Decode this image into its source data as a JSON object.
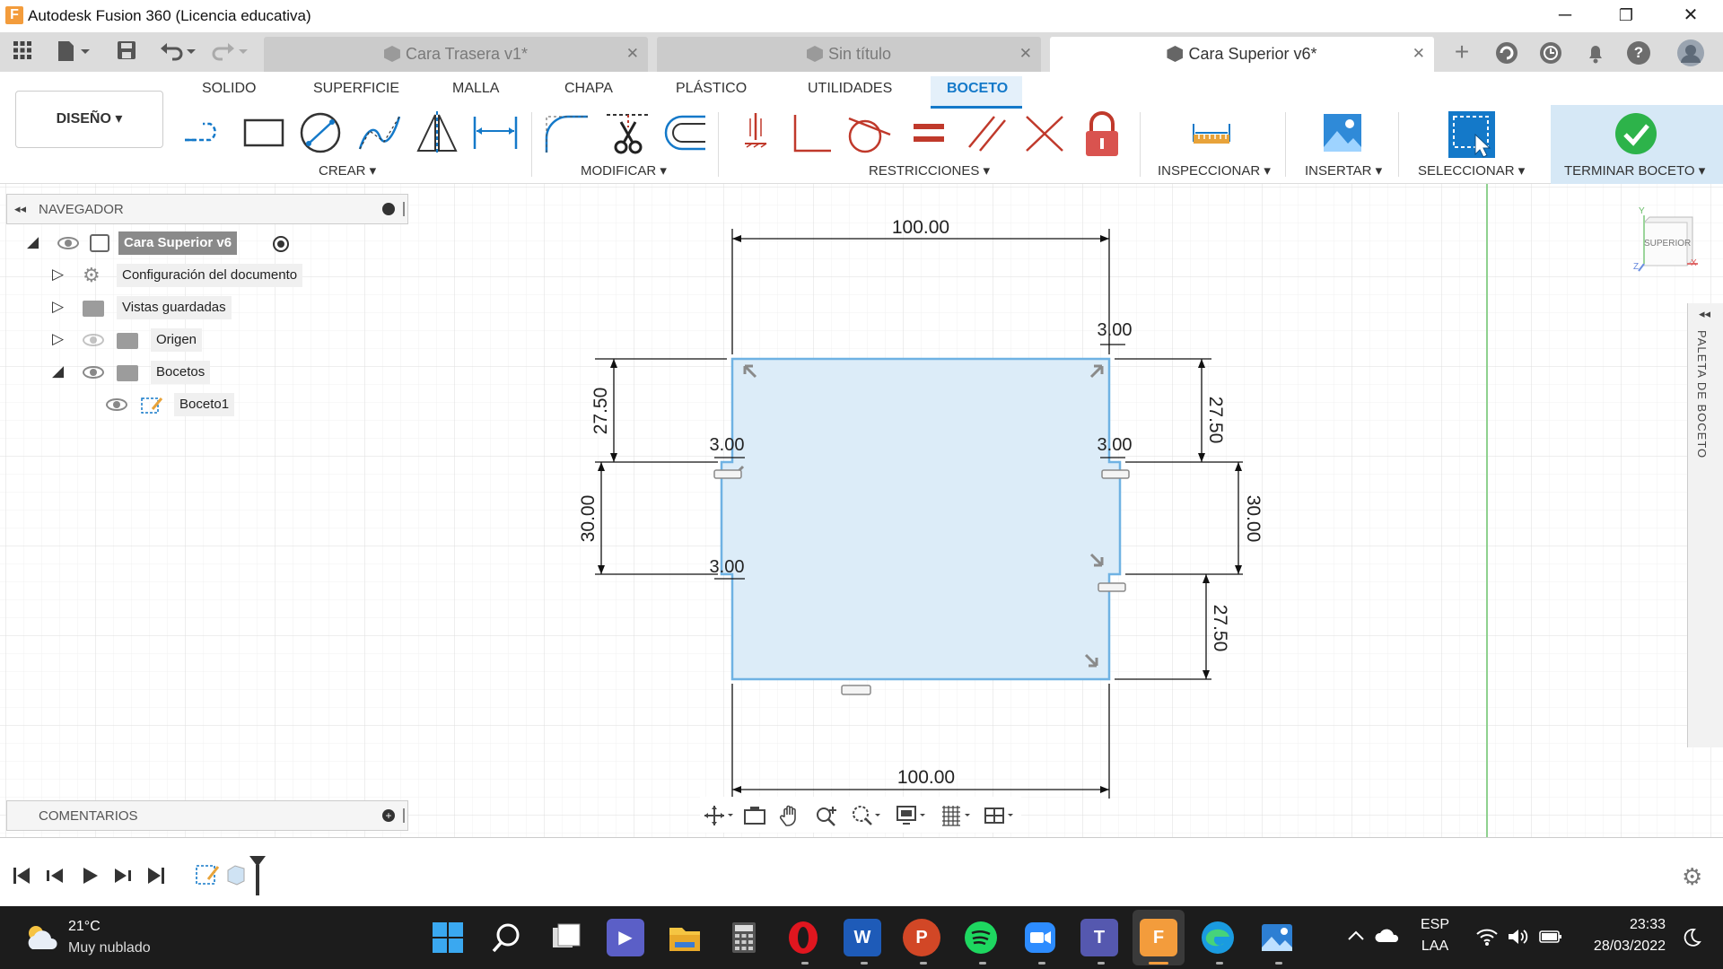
{
  "window": {
    "title": "Autodesk Fusion 360 (Licencia educativa)",
    "logo_letter": "F",
    "minimize": "─",
    "maximize": "❐",
    "close": "✕"
  },
  "tabs": [
    {
      "label": "Cara Trasera v1*",
      "active": false
    },
    {
      "label": "Sin título",
      "active": false
    },
    {
      "label": "Cara Superior v6*",
      "active": true
    }
  ],
  "tab_close": "✕",
  "tabbar_icons": {
    "add": "+",
    "help": "?"
  },
  "ribbon": {
    "tabs": [
      "SOLIDO",
      "SUPERFICIE",
      "MALLA",
      "CHAPA",
      "PLÁSTICO",
      "UTILIDADES",
      "BOCETO"
    ],
    "active_tab": "BOCETO",
    "workspace": "DISEÑO ▾",
    "groups": {
      "create": "CREAR ▾",
      "modify": "MODIFICAR ▾",
      "constraints": "RESTRICCIONES ▾",
      "inspect": "INSPECCIONAR ▾",
      "insert": "INSERTAR ▾",
      "select": "SELECCIONAR ▾",
      "finish": "TERMINAR BOCETO ▾"
    }
  },
  "navigator": {
    "title": "NAVEGADOR",
    "collapse": "◂◂",
    "items": [
      {
        "label": "Cara Superior v6"
      },
      {
        "label": "Configuración del documento"
      },
      {
        "label": "Vistas guardadas"
      },
      {
        "label": "Origen"
      },
      {
        "label": "Bocetos"
      },
      {
        "label": "Boceto1"
      }
    ]
  },
  "comments": {
    "title": "COMENTARIOS"
  },
  "viewcube": {
    "face": "SUPERIOR",
    "x": "X",
    "y": "Y",
    "z": "Z"
  },
  "palette": {
    "label": "PALETA DE BOCETO"
  },
  "sketch": {
    "dimensions": {
      "top_width": "100.00",
      "bottom_width": "100.00",
      "left_upper": "27.50",
      "left_middle": "30.00",
      "right_upper": "27.50",
      "right_middle": "30.00",
      "right_lower": "27.50",
      "notch_left_top": "3.00",
      "notch_left_bottom": "3.00",
      "notch_right_top": "3.00",
      "notch_right_mid": "3.00"
    }
  },
  "taskbar": {
    "weather_temp": "21°C",
    "weather_desc": "Muy nublado",
    "lang_top": "ESP",
    "lang_bottom": "LAA",
    "time": "23:33",
    "date": "28/03/2022"
  },
  "colors": {
    "accent": "#1479c9",
    "sketch_fill": "#dcecf8",
    "sketch_edge": "#6fb2e3",
    "grid": "#e6e6e6",
    "green_axis": "#7ccb7c"
  }
}
